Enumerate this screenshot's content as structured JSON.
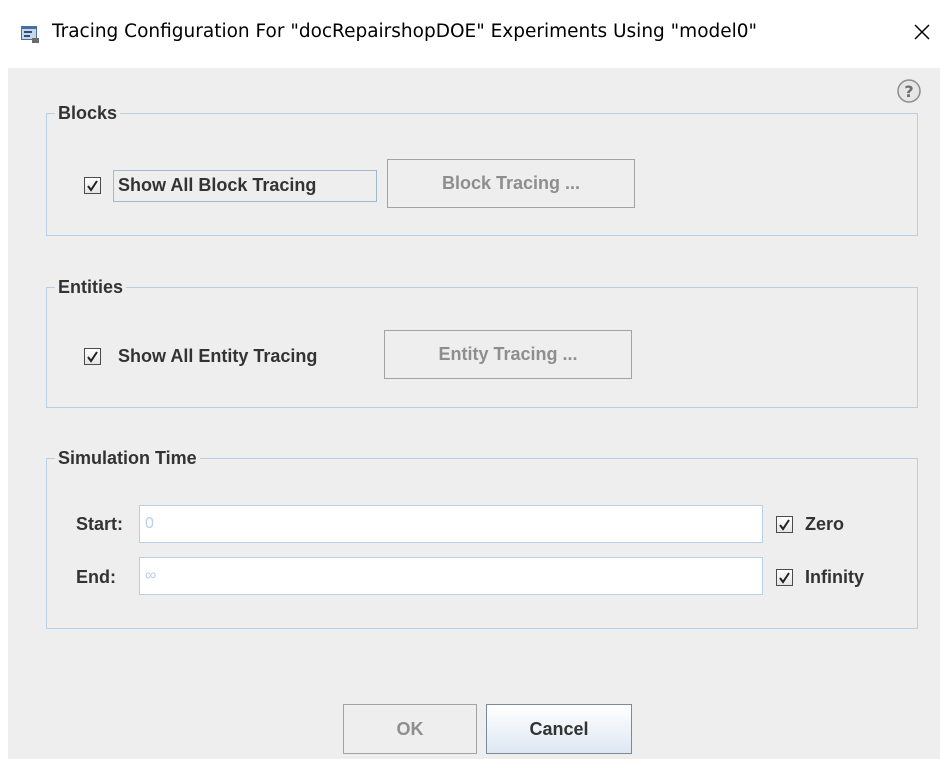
{
  "window": {
    "title": "Tracing Configuration For \"docRepairshopDOE\" Experiments Using \"model0\"",
    "close_glyph": "✕"
  },
  "icons": {
    "app": "app-window-icon",
    "help": "help-question-icon",
    "close": "close-icon",
    "check": "checkmark-icon"
  },
  "blocks": {
    "legend": "Blocks",
    "show_all_label": "Show All Block Tracing",
    "show_all_checked": true,
    "tracing_button": "Block Tracing ..."
  },
  "entities": {
    "legend": "Entities",
    "show_all_label": "Show All Entity Tracing",
    "show_all_checked": true,
    "tracing_button": "Entity Tracing ..."
  },
  "simulation_time": {
    "legend": "Simulation Time",
    "start_label": "Start:",
    "start_value": "0",
    "zero_label": "Zero",
    "zero_checked": true,
    "end_label": "End:",
    "end_value": "∞",
    "infinity_label": "Infinity",
    "infinity_checked": true
  },
  "buttons": {
    "ok": "OK",
    "cancel": "Cancel"
  },
  "colors": {
    "client_bg": "#eeeeee",
    "group_border": "#b8cfe5",
    "disabled_text": "#8e8e8e",
    "text": "#333333"
  }
}
